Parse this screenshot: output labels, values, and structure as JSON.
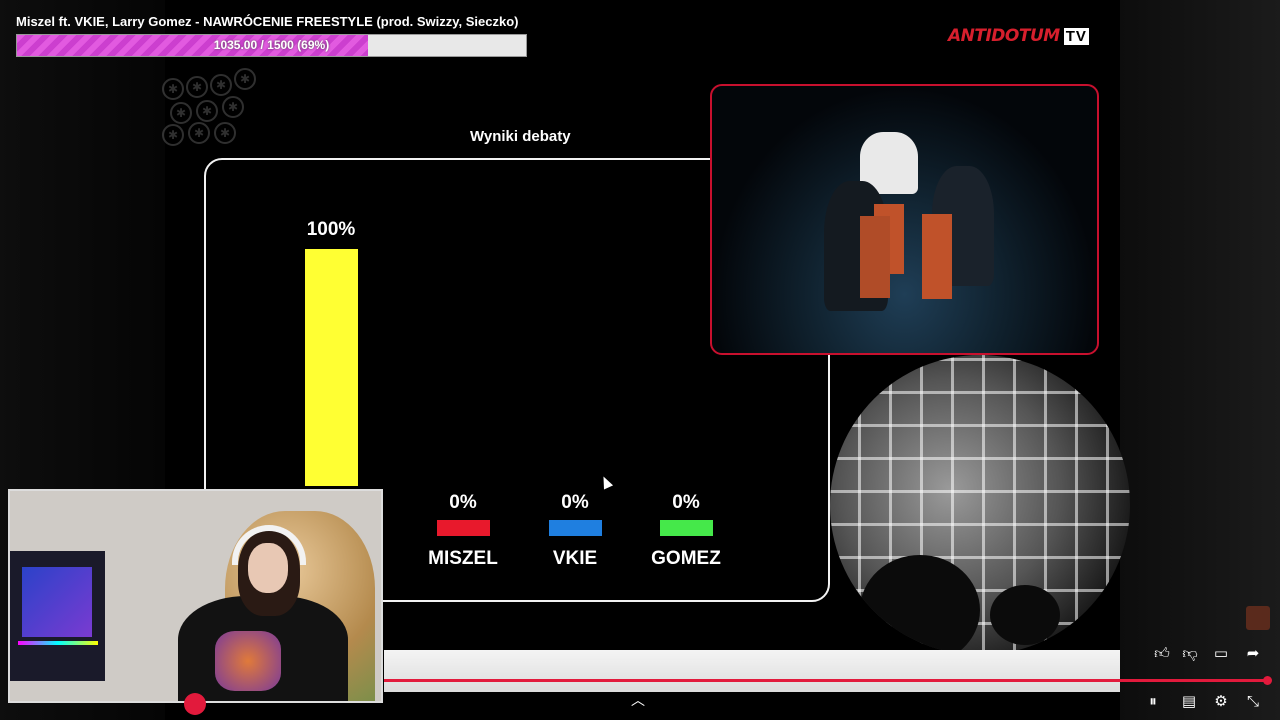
{
  "stream": {
    "title": "Miszel ft. VKIE, Larry Gomez - NAWRÓCENIE FREESTYLE (prod. Swizzy, Sieczko)",
    "goal_text": "1035.00 / 1500 (69%)",
    "goal_percent": 69
  },
  "logo": {
    "brand": "ANTIDOTUM",
    "suffix": "TV"
  },
  "chart_data": {
    "type": "bar",
    "title": "Wyniki debaty",
    "categories": [
      "",
      "MISZEL",
      "VKIE",
      "GOMEZ"
    ],
    "values": [
      100,
      0,
      0,
      0
    ],
    "value_labels": [
      "100%",
      "0%",
      "0%",
      "0%"
    ],
    "colors": [
      "#ffff33",
      "#e8192c",
      "#1f7fe0",
      "#45e84a"
    ],
    "ylim": [
      0,
      100
    ]
  },
  "player": {
    "progress_percent": 100,
    "icons": [
      "like-icon",
      "dislike-icon",
      "comment-icon",
      "share-icon",
      "pause-icon",
      "subtitles-icon",
      "settings-icon",
      "exit-fullscreen-icon",
      "chevron-up-icon"
    ]
  }
}
